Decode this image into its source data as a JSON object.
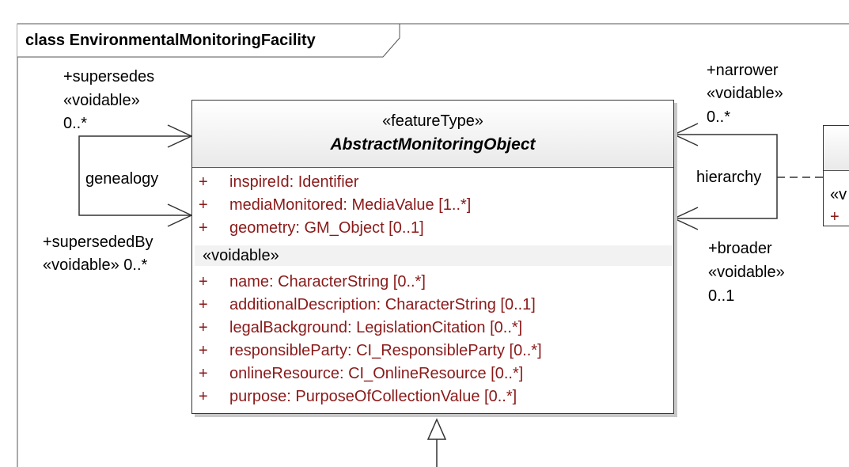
{
  "package": {
    "title": "class EnvironmentalMonitoringFacility"
  },
  "main_class": {
    "stereotype": "«featureType»",
    "name": "AbstractMonitoringObject",
    "attributes": [
      {
        "vis": "+",
        "text": "inspireId:  Identifier"
      },
      {
        "vis": "+",
        "text": "mediaMonitored:  MediaValue [1..*]"
      },
      {
        "vis": "+",
        "text": "geometry:  GM_Object [0..1]"
      }
    ],
    "voidable_label": "«voidable»",
    "voidable_attributes": [
      {
        "vis": "+",
        "text": "name:  CharacterString [0..*]"
      },
      {
        "vis": "+",
        "text": "additionalDescription:  CharacterString [0..1]"
      },
      {
        "vis": "+",
        "text": "legalBackground:  LegislationCitation [0..*]"
      },
      {
        "vis": "+",
        "text": "responsibleParty:  CI_ResponsibleParty [0..*]"
      },
      {
        "vis": "+",
        "text": "onlineResource:  CI_OnlineResource [0..*]"
      },
      {
        "vis": "+",
        "text": "purpose:  PurposeOfCollectionValue [0..*]"
      }
    ]
  },
  "genealogy": {
    "label": "genealogy",
    "supersedes": [
      "+supersedes",
      "«voidable»",
      "0..*"
    ],
    "superseded_by": [
      "+supersededBy",
      "«voidable» 0..*"
    ]
  },
  "hierarchy": {
    "label": "hierarchy",
    "narrower": [
      "+narrower",
      "«voidable»",
      "0..*"
    ],
    "broader": [
      "+broader",
      "«voidable»",
      "0..1"
    ]
  },
  "right_class": {
    "stereotype_partial": "«v",
    "plus": "+"
  }
}
